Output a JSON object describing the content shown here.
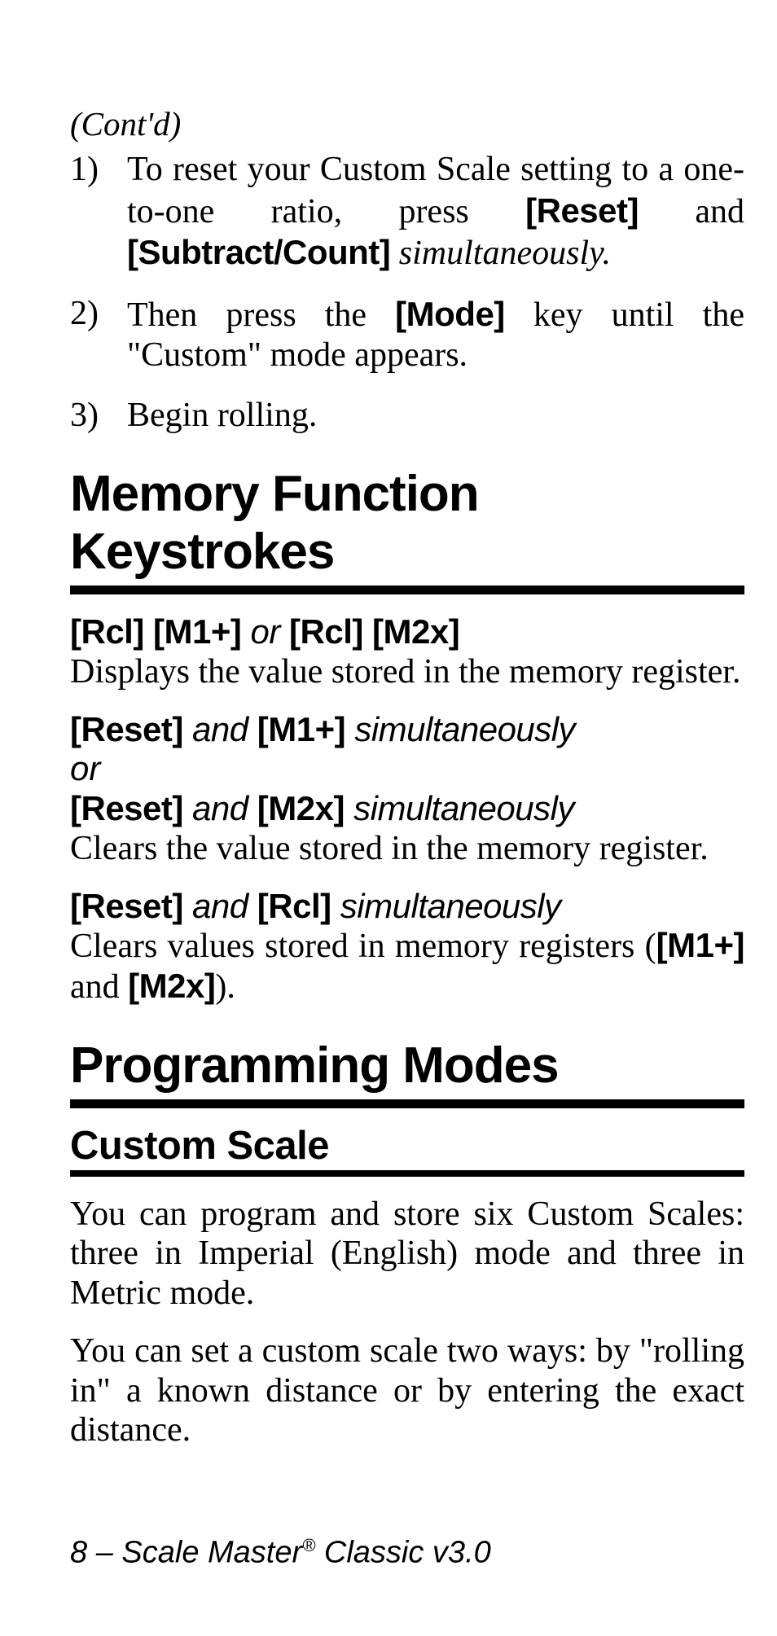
{
  "contd": "(Cont'd)",
  "steps": [
    {
      "num": "1)",
      "parts": [
        {
          "t": "text",
          "v": "To reset your Custom Scale setting to a one-to-one ratio, press "
        },
        {
          "t": "key",
          "v": "[Reset]"
        },
        {
          "t": "text",
          "v": " and "
        },
        {
          "t": "key",
          "v": "[Subtract/Count]"
        },
        {
          "t": "ital",
          "v": " simultaneously."
        }
      ]
    },
    {
      "num": "2)",
      "parts": [
        {
          "t": "text",
          "v": "Then press the "
        },
        {
          "t": "key",
          "v": "[Mode]"
        },
        {
          "t": "text",
          "v": " key until the \"Custom\" mode appears."
        }
      ]
    },
    {
      "num": "3)",
      "parts": [
        {
          "t": "text",
          "v": "Begin rolling."
        }
      ]
    }
  ],
  "section1": "Memory Function Keystrokes",
  "mem": [
    {
      "lead": [
        {
          "t": "key",
          "v": "[Rcl] [M1+]"
        },
        {
          "t": "ital-sans",
          "v": "  or  "
        },
        {
          "t": "key",
          "v": "[Rcl] [M2x]"
        }
      ],
      "desc": [
        {
          "t": "text",
          "v": "Displays the value stored in the memory register."
        }
      ]
    },
    {
      "lead": [
        {
          "t": "key",
          "v": "[Reset]"
        },
        {
          "t": "ital-sans",
          "v": " and "
        },
        {
          "t": "key",
          "v": "[M1+]"
        },
        {
          "t": "ital-sans",
          "v": " simultaneously"
        }
      ],
      "or": "or",
      "lead2": [
        {
          "t": "key",
          "v": "[Reset]"
        },
        {
          "t": "ital-sans",
          "v": " and "
        },
        {
          "t": "key",
          "v": "[M2x]"
        },
        {
          "t": "ital-sans",
          "v": " simultaneously"
        }
      ],
      "desc": [
        {
          "t": "text",
          "v": "Clears the value stored in the memory register."
        }
      ]
    },
    {
      "lead": [
        {
          "t": "key",
          "v": "[Reset]"
        },
        {
          "t": "ital-sans",
          "v": " and "
        },
        {
          "t": "key",
          "v": "[Rcl]"
        },
        {
          "t": "ital-sans",
          "v": " simultaneously"
        }
      ],
      "desc": [
        {
          "t": "text",
          "v": "Clears values stored in memory registers ("
        },
        {
          "t": "key",
          "v": "[M1+]"
        },
        {
          "t": "text",
          "v": " and "
        },
        {
          "t": "key",
          "v": "[M2x]"
        },
        {
          "t": "text",
          "v": ")."
        }
      ]
    }
  ],
  "section2": "Programming Modes",
  "subsection": "Custom Scale",
  "paras": [
    "You can program and store six Custom Scales: three in Imperial (English) mode and three in Metric mode.",
    "You can set a custom scale two ways: by \"rolling in\" a known distance or by entering the exact distance."
  ],
  "footer": {
    "page": "8",
    "sep": " – ",
    "title_a": "Scale Master",
    "reg": "®",
    "title_b": " Classic v3.0"
  }
}
